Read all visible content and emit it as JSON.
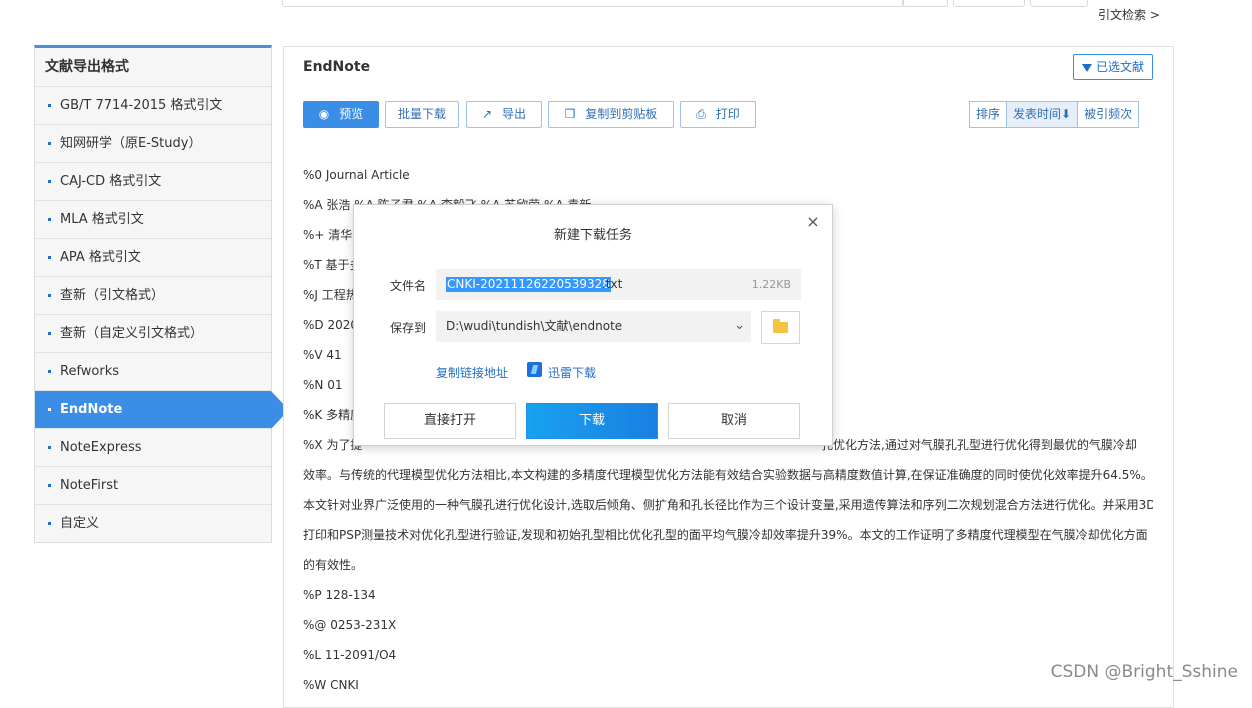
{
  "top": {
    "cite_search": "引文检索  >"
  },
  "sidebar": {
    "title": "文献导出格式",
    "items": [
      {
        "label": "GB/T 7714-2015 格式引文"
      },
      {
        "label": "知网研学（原E-Study）"
      },
      {
        "label": "CAJ-CD 格式引文"
      },
      {
        "label": "MLA 格式引文"
      },
      {
        "label": "APA 格式引文"
      },
      {
        "label": "查新（引文格式）"
      },
      {
        "label": "查新（自定义引文格式）"
      },
      {
        "label": "Refworks"
      },
      {
        "label": "EndNote",
        "active": true
      },
      {
        "label": "NoteExpress"
      },
      {
        "label": "NoteFirst"
      },
      {
        "label": "自定义"
      }
    ]
  },
  "main": {
    "title": "EndNote",
    "selected_label": "已选文献",
    "toolbar": {
      "preview": "预览",
      "batch_download": "批量下载",
      "export": "导出",
      "copy": "复制到剪贴板",
      "print": "打印"
    },
    "sort": {
      "label": "排序",
      "pub_time": "发表时间⬇",
      "cited": "被引频次"
    },
    "record": {
      "l1": "%0 Journal Article",
      "l2": "%A 张浩 %A 陈子君 %A 李毅飞 %A 苏欣荣 %A 袁新",
      "l3": "%+ 清华大",
      "l4": "%T 基于多",
      "l5": "%J 工程热",
      "l6": "%D 2020",
      "l7": "%V 41",
      "l8": "%N 01",
      "l9": "%K 多精度",
      "abs1_a": "%X 为了提",
      "abs1_b": "孔优化方法,通过对气膜孔孔型进行优化得到最优的气膜冷却",
      "abs2": "效率。与传统的代理模型优化方法相比,本文构建的多精度代理模型优化方法能有效结合实验数据与高精度数值计算,在保证准确度的同时使优化效率提升64.5%。",
      "abs3": "本文针对业界广泛使用的一种气膜孔进行优化设计,选取后倾角、侧扩角和孔长径比作为三个设计变量,采用遗传算法和序列二次规划混合方法进行优化。并采用3D",
      "abs4": "打印和PSP测量技术对优化孔型进行验证,发现和初始孔型相比优化孔型的面平均气膜冷却效率提升39%。本文的工作证明了多精度代理模型在气膜冷却优化方面",
      "abs5": "的有效性。",
      "l10": "%P 128-134",
      "l11": "%@ 0253-231X",
      "l12": "%L 11-2091/O4",
      "l13": "%W CNKI"
    }
  },
  "dialog": {
    "title": "新建下载任务",
    "filename_label": "文件名",
    "filename_selected": "CNKI-20211126220539328",
    "filename_ext": ".txt",
    "file_size": "1.22KB",
    "saveto_label": "保存到",
    "save_path": "D:\\wudi\\tundish\\文献\\endnote",
    "copy_link": "复制链接地址",
    "thunder": "迅雷下载",
    "open_direct": "直接打开",
    "download": "下载",
    "cancel": "取消",
    "close": "×"
  },
  "watermark": "CSDN @Bright_Sshine"
}
